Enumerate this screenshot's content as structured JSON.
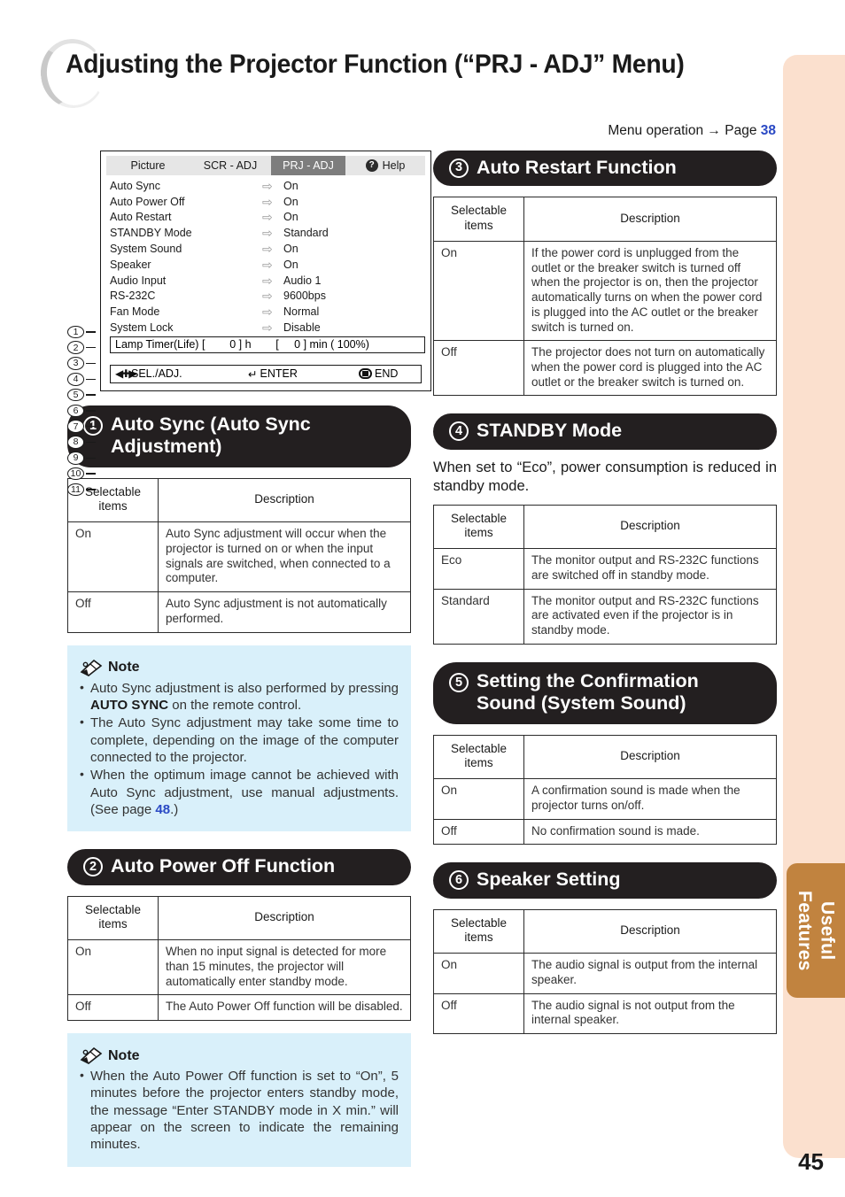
{
  "page": {
    "title": "Adjusting the Projector Function (“PRJ - ADJ” Menu)",
    "menu_operation": "Menu operation",
    "menu_operation_arrow": "→",
    "menu_operation_page_label": "Page",
    "menu_operation_page_number": "38",
    "page_number": "45",
    "side_tab": "Useful\nFeatures",
    "accent_tab_color": "#c1833f",
    "edge_strip_color": "#fbe0ce",
    "note_bg_color": "#d9f0fa",
    "link_color": "#2a49c4",
    "header_bg_color": "#231f20"
  },
  "osd": {
    "tabs": [
      {
        "label": "Picture",
        "selected": false
      },
      {
        "label": "SCR - ADJ",
        "selected": false
      },
      {
        "label": "PRJ - ADJ",
        "selected": true
      },
      {
        "label": "Help",
        "selected": false
      }
    ],
    "help_icon": "question-mark-icon",
    "arrow_glyph": "⇨",
    "rows": [
      {
        "num": "1",
        "name": "Auto Sync",
        "value": "On"
      },
      {
        "num": "2",
        "name": "Auto Power Off",
        "value": "On"
      },
      {
        "num": "3",
        "name": "Auto Restart",
        "value": "On"
      },
      {
        "num": "4",
        "name": "STANDBY Mode",
        "value": "Standard"
      },
      {
        "num": "5",
        "name": "System Sound",
        "value": "On"
      },
      {
        "num": "6",
        "name": "Speaker",
        "value": "On"
      },
      {
        "num": "7",
        "name": "Audio Input",
        "value": "Audio 1"
      },
      {
        "num": "8",
        "name": "RS-232C",
        "value": "9600bps"
      },
      {
        "num": "9",
        "name": "Fan Mode",
        "value": "Normal"
      },
      {
        "num": "10",
        "name": "System Lock",
        "value": "Disable"
      }
    ],
    "lamp_row": {
      "num": "11",
      "text": "Lamp Timer(Life) [        0 ] h        [     0 ] min ( 100%)"
    },
    "nav": {
      "sel_adj": "SEL./ADJ.",
      "enter": "ENTER",
      "enter_glyph": "↵",
      "end": "END"
    }
  },
  "sections": [
    {
      "id": "auto-sync",
      "num": "①",
      "num_plain": "1",
      "title": "Auto Sync (Auto Sync Adjustment)",
      "table": {
        "headers": [
          "Selectable items",
          "Description"
        ],
        "rows": [
          [
            "On",
            "Auto Sync adjustment will occur when the projector is turned on or when the input signals are switched, when connected to a computer."
          ],
          [
            "Off",
            "Auto Sync adjustment is not automatically performed."
          ]
        ]
      }
    },
    {
      "id": "auto-power-off",
      "num": "②",
      "num_plain": "2",
      "title": "Auto Power Off Function",
      "table": {
        "headers": [
          "Selectable items",
          "Description"
        ],
        "rows": [
          [
            "On",
            "When no input signal is detected for more than 15 minutes, the projector will automatically enter standby mode."
          ],
          [
            "Off",
            "The Auto Power Off function will be disabled."
          ]
        ]
      }
    },
    {
      "id": "auto-restart",
      "num": "③",
      "num_plain": "3",
      "title": "Auto Restart Function",
      "table": {
        "headers": [
          "Selectable items",
          "Description"
        ],
        "rows": [
          [
            "On",
            "If the power cord is unplugged from the outlet or the breaker switch is turned off when the projector is on, then the projector automatically turns on when the power cord is plugged into the AC outlet or the breaker switch is turned on."
          ],
          [
            "Off",
            "The projector does not turn on automatically when the power cord is plugged into the AC outlet or the breaker switch is turned on."
          ]
        ]
      }
    },
    {
      "id": "standby-mode",
      "num": "④",
      "num_plain": "4",
      "title": "STANDBY Mode",
      "intro": "When set to “Eco”, power consumption is reduced in standby mode.",
      "table": {
        "headers": [
          "Selectable items",
          "Description"
        ],
        "rows": [
          [
            "Eco",
            "The monitor output and RS-232C functions are switched off in standby mode."
          ],
          [
            "Standard",
            "The monitor output and RS-232C functions are activated even if the projector is in standby mode."
          ]
        ]
      }
    },
    {
      "id": "system-sound",
      "num": "⑤",
      "num_plain": "5",
      "title": "Setting the Confirmation Sound (System Sound)",
      "table": {
        "headers": [
          "Selectable items",
          "Description"
        ],
        "rows": [
          [
            "On",
            "A confirmation sound is made when the projector turns on/off."
          ],
          [
            "Off",
            "No confirmation sound is made."
          ]
        ]
      }
    },
    {
      "id": "speaker-setting",
      "num": "⑥",
      "num_plain": "6",
      "title": "Speaker Setting",
      "table": {
        "headers": [
          "Selectable items",
          "Description"
        ],
        "rows": [
          [
            "On",
            "The audio signal is output from the internal speaker."
          ],
          [
            "Off",
            "The audio signal is not output from the internal speaker."
          ]
        ]
      }
    }
  ],
  "notes": [
    {
      "id": "note-auto-sync",
      "label": "Note",
      "items": [
        {
          "pre": "Auto Sync adjustment is also performed by pressing ",
          "bold": "AUTO SYNC",
          "post": " on the remote control."
        },
        {
          "pre": "The Auto Sync adjustment may take some time to complete, depending on the image of the computer connected to the projector.",
          "bold": "",
          "post": ""
        },
        {
          "pre": "When the optimum image cannot be achieved with Auto Sync adjustment, use manual adjustments. (See page ",
          "link": "48",
          "post": ".)"
        }
      ]
    },
    {
      "id": "note-auto-power-off",
      "label": "Note",
      "items": [
        {
          "pre": "When the Auto Power Off function is set to “On”, 5 minutes before the projector enters standby mode, the message “Enter STANDBY mode in X min.” will appear on the screen to indicate the remaining minutes.",
          "bold": "",
          "post": ""
        }
      ]
    }
  ]
}
